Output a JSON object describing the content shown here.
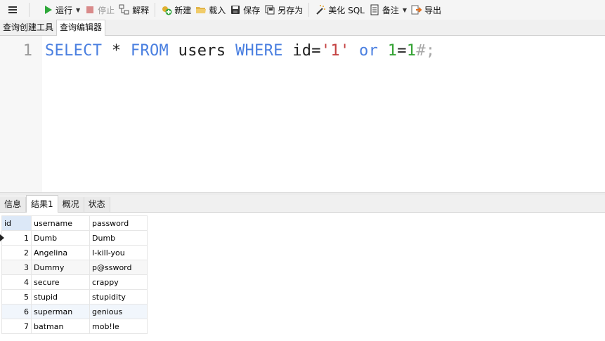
{
  "toolbar": {
    "run": "运行",
    "stop": "停止",
    "explain": "解释",
    "new": "新建",
    "load": "载入",
    "save": "保存",
    "save_as": "另存为",
    "beautify": "美化 SQL",
    "notes": "备注",
    "export": "导出"
  },
  "tabs": [
    "查询创建工具",
    "查询编辑器"
  ],
  "editor": {
    "line_number": "1",
    "tokens": {
      "select": "SELECT",
      "star": " * ",
      "from": "FROM",
      "table": " users ",
      "where": "WHERE",
      "cond": " id=",
      "value": "'1'",
      "sp": " ",
      "or": "or",
      "sp2": " ",
      "one_a": "1",
      "eq": "=",
      "one_b": "1",
      "comment": "#;"
    }
  },
  "result_tabs": [
    "信息",
    "结果1",
    "概况",
    "状态"
  ],
  "grid": {
    "columns": [
      "id",
      "username",
      "password"
    ],
    "rows": [
      [
        "1",
        "Dumb",
        "Dumb"
      ],
      [
        "2",
        "Angelina",
        "I-kill-you"
      ],
      [
        "3",
        "Dummy",
        "p@ssword"
      ],
      [
        "4",
        "secure",
        "crappy"
      ],
      [
        "5",
        "stupid",
        "stupidity"
      ],
      [
        "6",
        "superman",
        "genious"
      ],
      [
        "7",
        "batman",
        "mob!le"
      ]
    ]
  },
  "colors": {
    "keyword": "#4a7fe0",
    "string": "#c44040",
    "number": "#35a335",
    "comment": "#a8a8a8",
    "run_icon": "#2ea83a",
    "stop_icon": "#d98a8a"
  }
}
